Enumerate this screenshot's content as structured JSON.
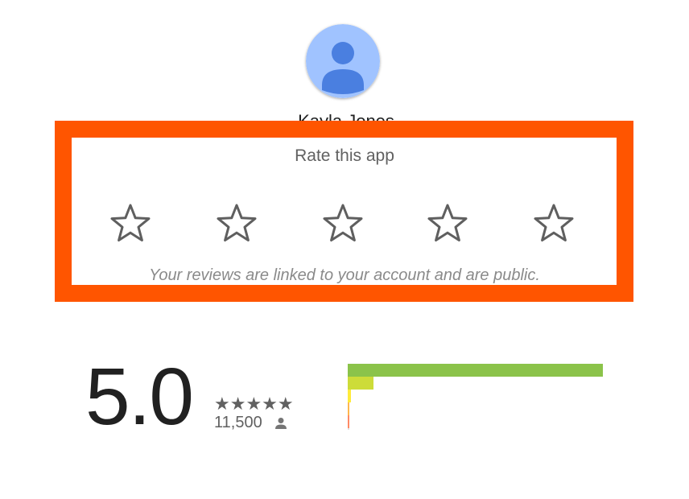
{
  "profile": {
    "avatar_icon": "user-avatar-icon",
    "name": "Kayla Jones"
  },
  "rate": {
    "title": "Rate this app",
    "star_icon": "star-outline-icon",
    "stars": [
      1,
      2,
      3,
      4,
      5
    ],
    "disclaimer": "Your reviews are linked to your account and are public."
  },
  "summary": {
    "average": "5.0",
    "stars_display": "★★★★★",
    "count": "11,500",
    "count_icon": "person-icon"
  },
  "histogram": {
    "levels": [
      {
        "stars": 5,
        "fraction": 0.985,
        "color": "#8bc34a"
      },
      {
        "stars": 4,
        "fraction": 0.1,
        "color": "#cddc39"
      },
      {
        "stars": 3,
        "fraction": 0.012,
        "color": "#ffeb3b"
      },
      {
        "stars": 2,
        "fraction": 0.006,
        "color": "#ffb74d"
      },
      {
        "stars": 1,
        "fraction": 0.006,
        "color": "#ff8a65"
      }
    ]
  },
  "colors": {
    "highlight": "#ff5500",
    "avatar_bg": "#a0c3ff",
    "avatar_fg": "#4a7fe0"
  }
}
